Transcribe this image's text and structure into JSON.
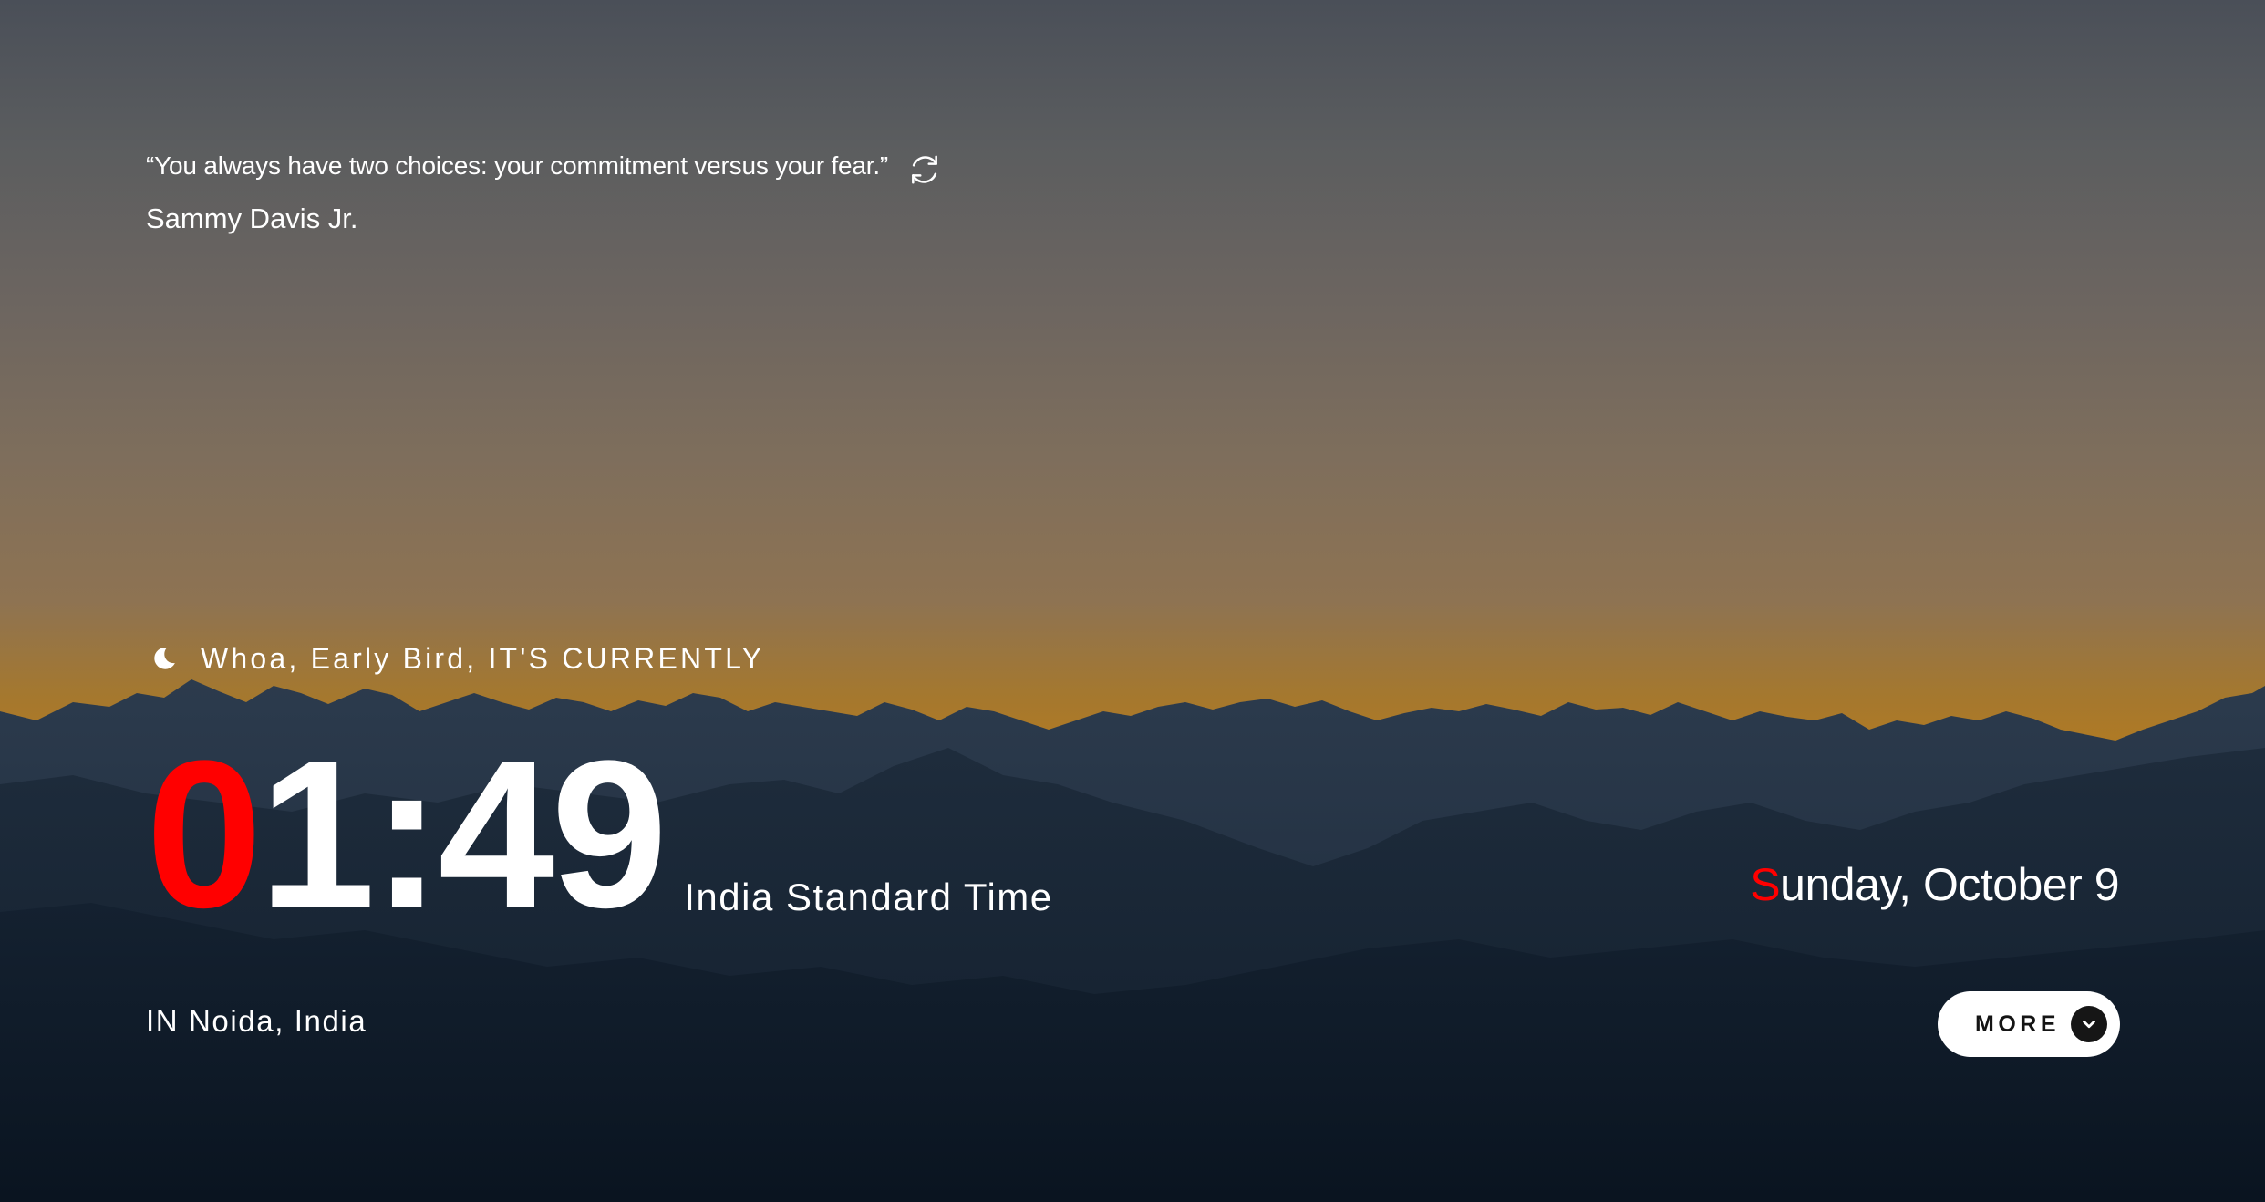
{
  "quote": {
    "text": "“You always have two choices: your commitment versus your fear.”",
    "author": "Sammy Davis Jr.",
    "refresh_icon": "refresh-icon"
  },
  "greeting": {
    "icon": "moon-icon",
    "text": "Whoa, Early Bird, IT'S CURRENTLY"
  },
  "clock": {
    "time_first_char": "0",
    "time_rest": "1:49",
    "timezone": "India Standard Time"
  },
  "date": {
    "first_char": "S",
    "rest": "unday, October 9"
  },
  "location": {
    "text": "IN Noida, India"
  },
  "more_button": {
    "label": "MORE",
    "icon": "chevron-down-icon"
  },
  "colors": {
    "accent": "#ff0000",
    "text": "#ffffff",
    "button_bg": "#ffffff",
    "button_text": "#141414"
  }
}
